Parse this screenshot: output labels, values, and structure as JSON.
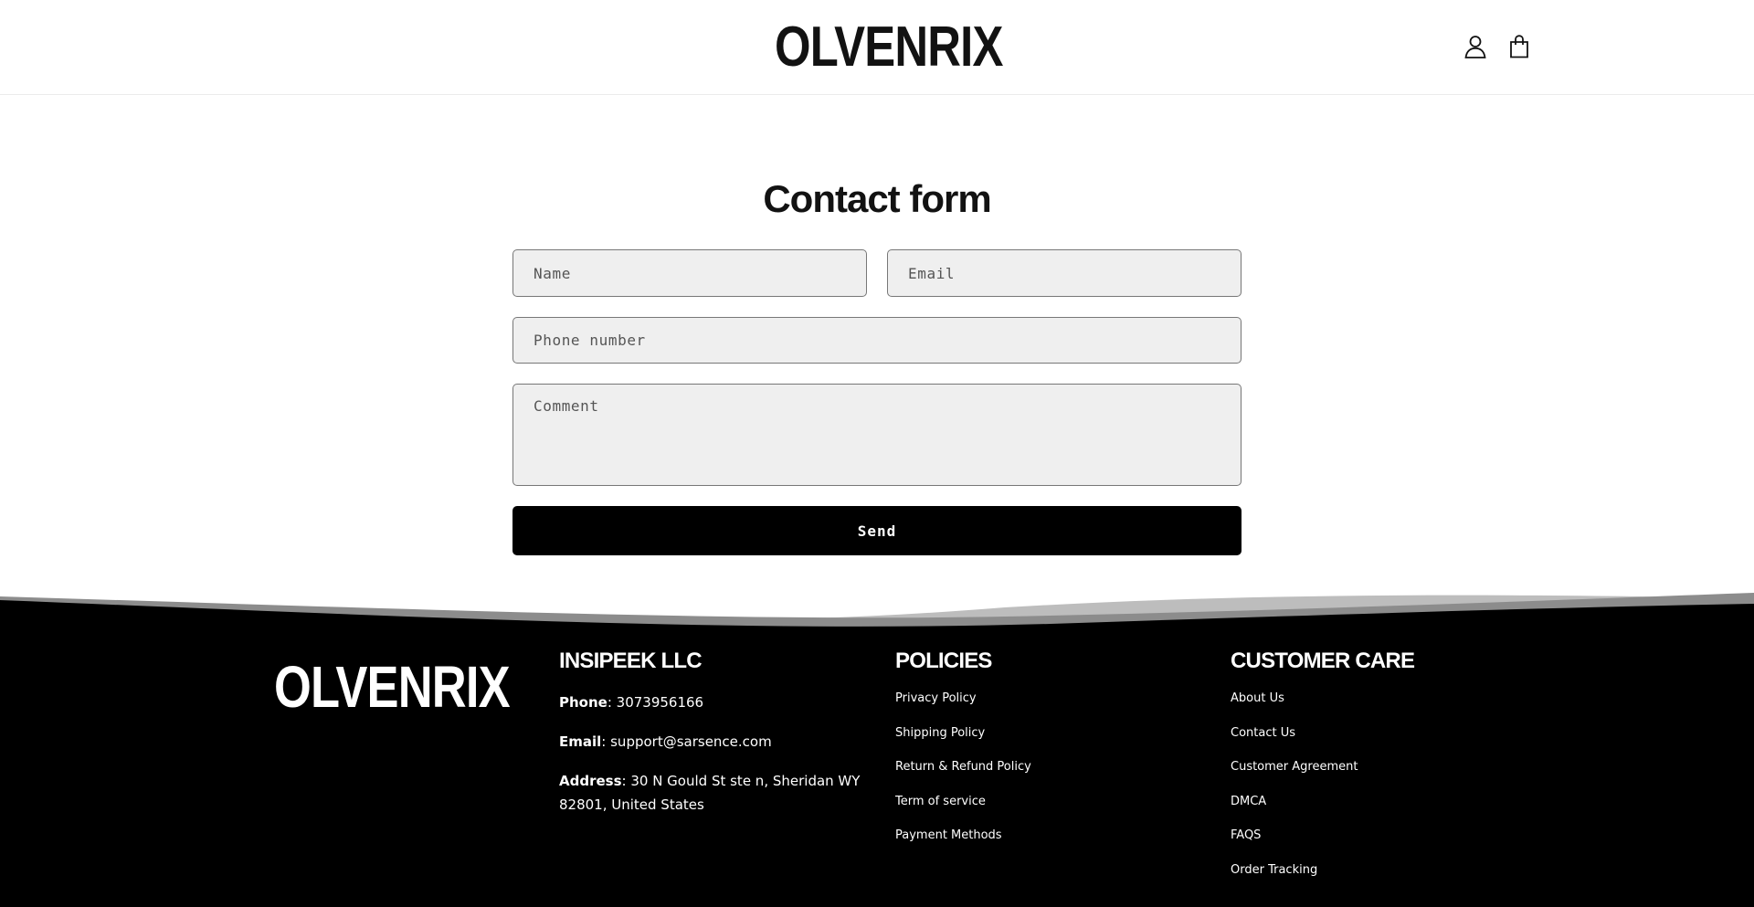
{
  "header": {
    "brand": "OLVENRIX",
    "account_icon": "user-icon",
    "cart_icon": "shopping-bag-icon"
  },
  "contact_form": {
    "title": "Contact form",
    "name_placeholder": "Name",
    "email_placeholder": "Email",
    "phone_placeholder": "Phone number",
    "comment_placeholder": "Comment",
    "send_label": "Send"
  },
  "footer": {
    "brand": "OLVENRIX",
    "company": {
      "heading": "INSIPEEK LLC",
      "phone_label": "Phone",
      "phone_value": ": 3073956166",
      "email_label": "Email",
      "email_value": ": support@sarsence.com",
      "address_label": "Address",
      "address_value": ": 30 N Gould St ste n, Sheridan WY 82801, United States"
    },
    "policies": {
      "heading": "POLICIES",
      "links": [
        "Privacy Policy",
        "Shipping Policy",
        "Return & Refund Policy",
        "Term of service",
        "Payment Methods"
      ]
    },
    "customer_care": {
      "heading": "CUSTOMER CARE",
      "links": [
        "About Us",
        "Contact Us",
        "Customer Agreement",
        "DMCA",
        "FAQS",
        "Order Tracking"
      ]
    }
  },
  "colors": {
    "footer_bg": "#000000",
    "field_bg": "#efefef",
    "button_bg": "#000000"
  }
}
